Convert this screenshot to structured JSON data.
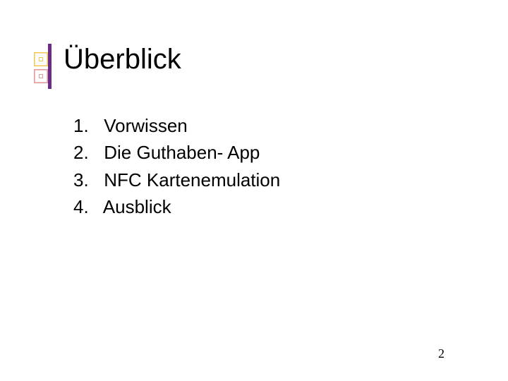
{
  "title": "Überblick",
  "items": [
    {
      "number": "1.",
      "text": "Vorwissen"
    },
    {
      "number": "2.",
      "text": "Die Guthaben- App"
    },
    {
      "number": "3.",
      "text": "NFC Kartenemulation"
    },
    {
      "number": "4.",
      "text": "Ausblick"
    }
  ],
  "pageNumber": "2"
}
